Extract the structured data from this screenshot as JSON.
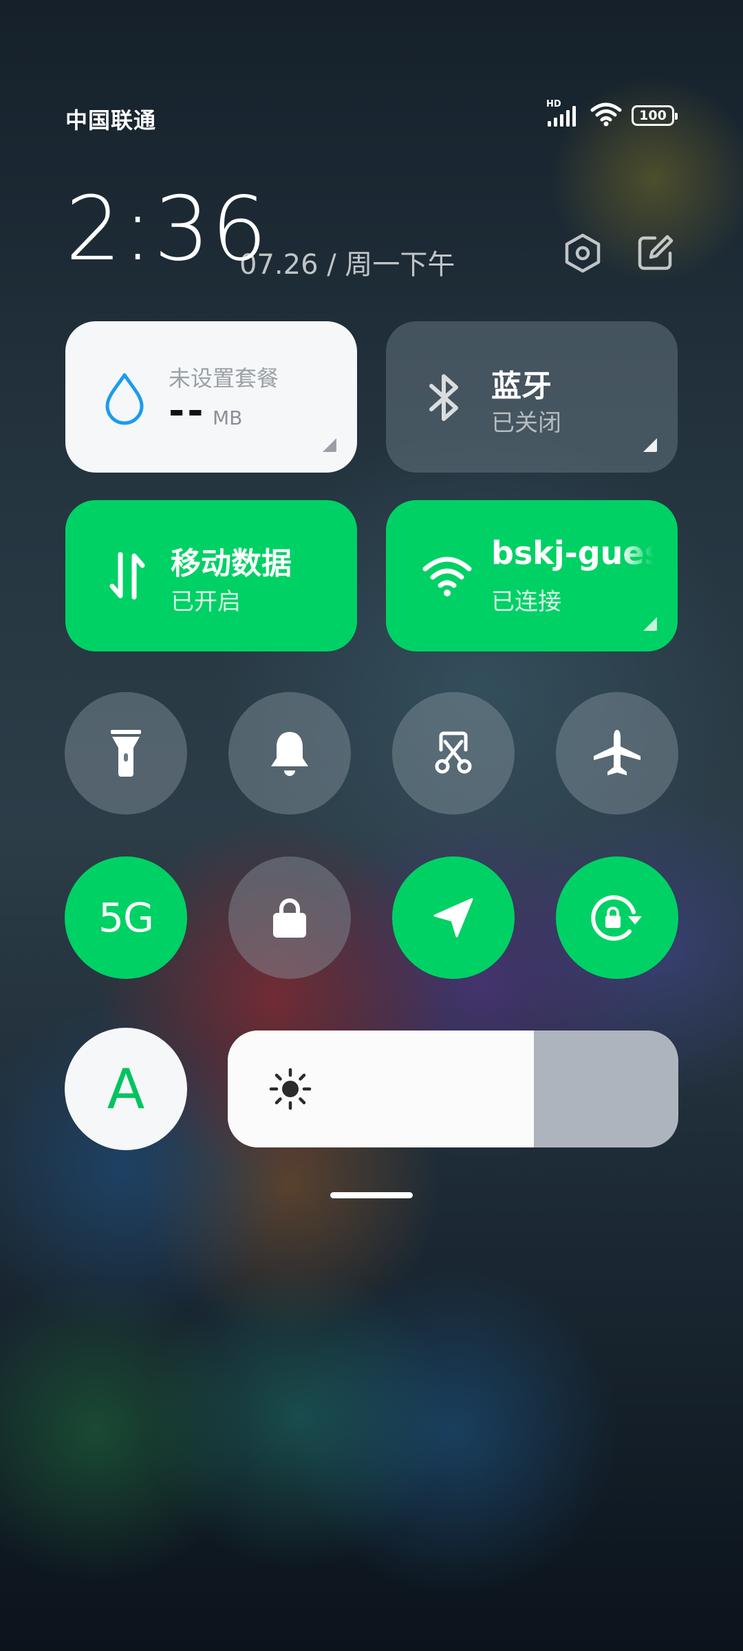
{
  "status_bar": {
    "carrier": "中国联通",
    "network_badge": "HD",
    "battery_level": "100",
    "icons": [
      "signal-icon",
      "wifi-icon",
      "battery-icon"
    ]
  },
  "header": {
    "time": "2:36",
    "date": "07.26 / 周一下午",
    "icons": [
      "settings-icon",
      "edit-icon"
    ]
  },
  "tiles": {
    "data_plan": {
      "title": "未设置套餐",
      "value": "--",
      "unit": "MB",
      "icon": "water-drop-icon"
    },
    "bluetooth": {
      "title": "蓝牙",
      "status": "已关闭",
      "icon": "bluetooth-icon"
    },
    "mobile_data": {
      "title": "移动数据",
      "status": "已开启",
      "icon": "data-arrows-icon"
    },
    "wifi": {
      "title": "bskj-guest",
      "status": "已连接",
      "icon": "wifi-icon"
    }
  },
  "toggles_row1": [
    {
      "name": "flashlight",
      "icon": "flashlight-icon",
      "active": false
    },
    {
      "name": "ringer",
      "icon": "bell-icon",
      "active": false
    },
    {
      "name": "screenshot",
      "icon": "screenshot-scissors-icon",
      "active": false
    },
    {
      "name": "airplane-mode",
      "icon": "airplane-icon",
      "active": false
    }
  ],
  "toggles_row2": [
    {
      "name": "5g",
      "label": "5G",
      "active": true
    },
    {
      "name": "lock-screen",
      "icon": "lock-icon",
      "active": false
    },
    {
      "name": "location",
      "icon": "location-arrow-icon",
      "active": true
    },
    {
      "name": "rotation-lock",
      "icon": "rotation-lock-icon",
      "active": true
    }
  ],
  "bottom": {
    "auto_brightness_label": "A",
    "brightness_level": 0.68,
    "icon": "sun-icon"
  },
  "colors": {
    "accent_green": "#00d165",
    "tile_white": "#f6f7f8",
    "drop_blue": "#1c9bf0"
  }
}
